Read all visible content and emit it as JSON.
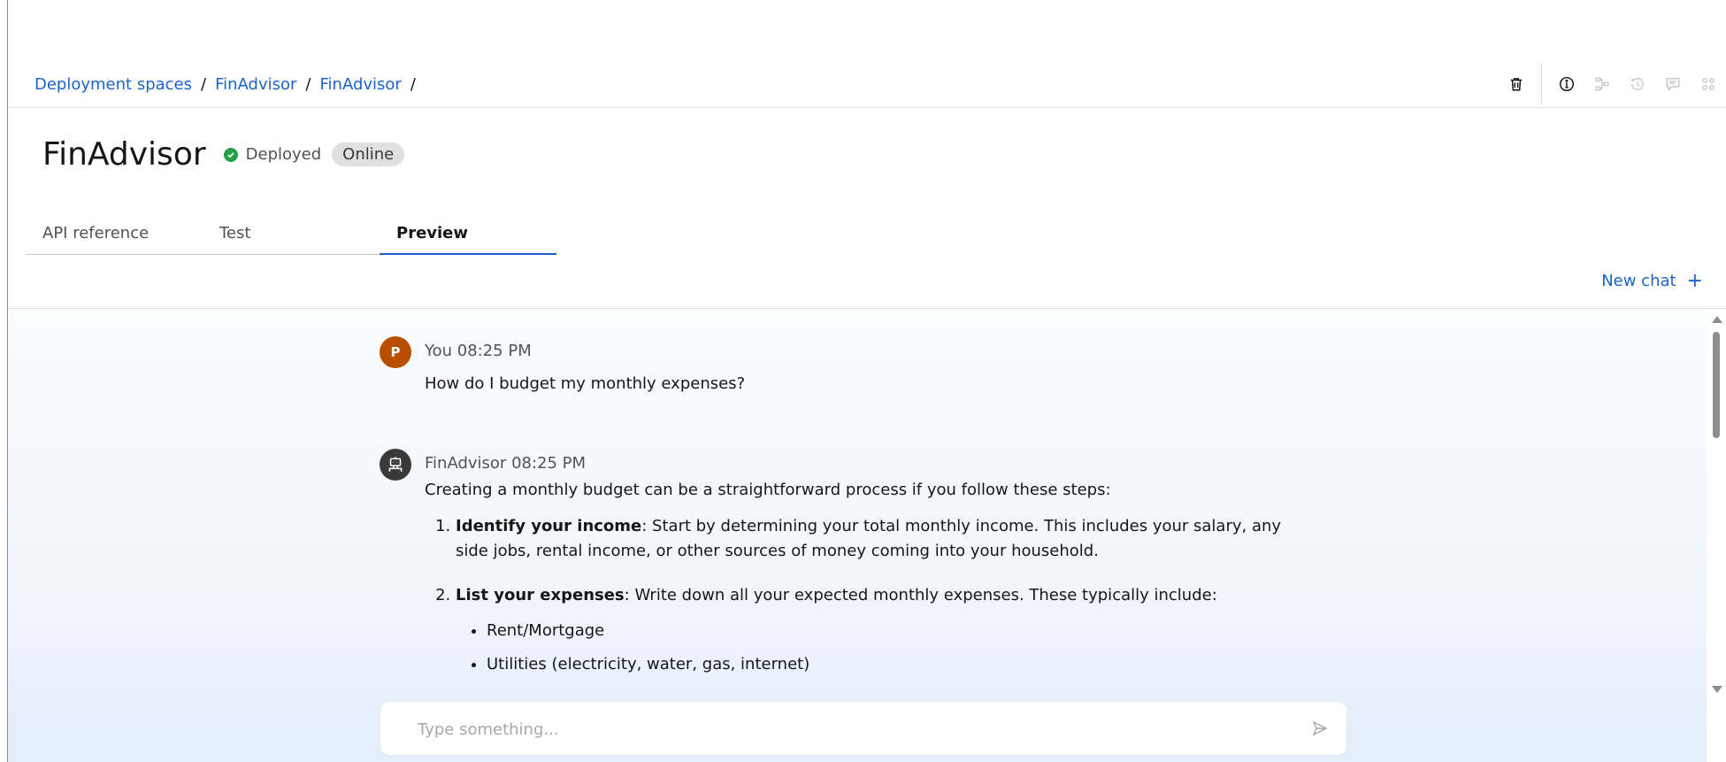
{
  "breadcrumb": {
    "items": [
      "Deployment spaces",
      "FinAdvisor",
      "FinAdvisor"
    ],
    "separator": "/"
  },
  "toolbar": {
    "icons": [
      "trash-icon",
      "info-icon",
      "lineage-icon",
      "history-icon",
      "comments-icon",
      "apps-icon"
    ]
  },
  "header": {
    "title": "FinAdvisor",
    "status": "Deployed",
    "status_color": "#24a148",
    "tag": "Online"
  },
  "tabs": [
    {
      "label": "API reference",
      "active": false
    },
    {
      "label": "Test",
      "active": false
    },
    {
      "label": "Preview",
      "active": true
    }
  ],
  "new_chat": {
    "label": "New chat",
    "icon": "+"
  },
  "chat": {
    "messages": [
      {
        "avatar_initial": "P",
        "avatar_color": "#ba4e00",
        "sender": "You",
        "time": "08:25 PM",
        "text": "How do I budget my monthly expenses?"
      },
      {
        "avatar_icon": "robot-icon",
        "sender": "FinAdvisor",
        "time": "08:25 PM",
        "intro": "Creating a monthly budget can be a straightforward process if you follow these steps:",
        "steps": [
          {
            "title": "Identify your income",
            "text": ": Start by determining your total monthly income. This includes your salary, any side jobs, rental income, or other sources of money coming into your household."
          },
          {
            "title": "List your expenses",
            "text": ": Write down all your expected monthly expenses. These typically include:",
            "bullets": [
              "Rent/Mortgage",
              "Utilities (electricity, water, gas, internet)"
            ]
          }
        ]
      }
    ]
  },
  "input": {
    "placeholder": "Type something..."
  },
  "accent_color": "#1d63c7"
}
